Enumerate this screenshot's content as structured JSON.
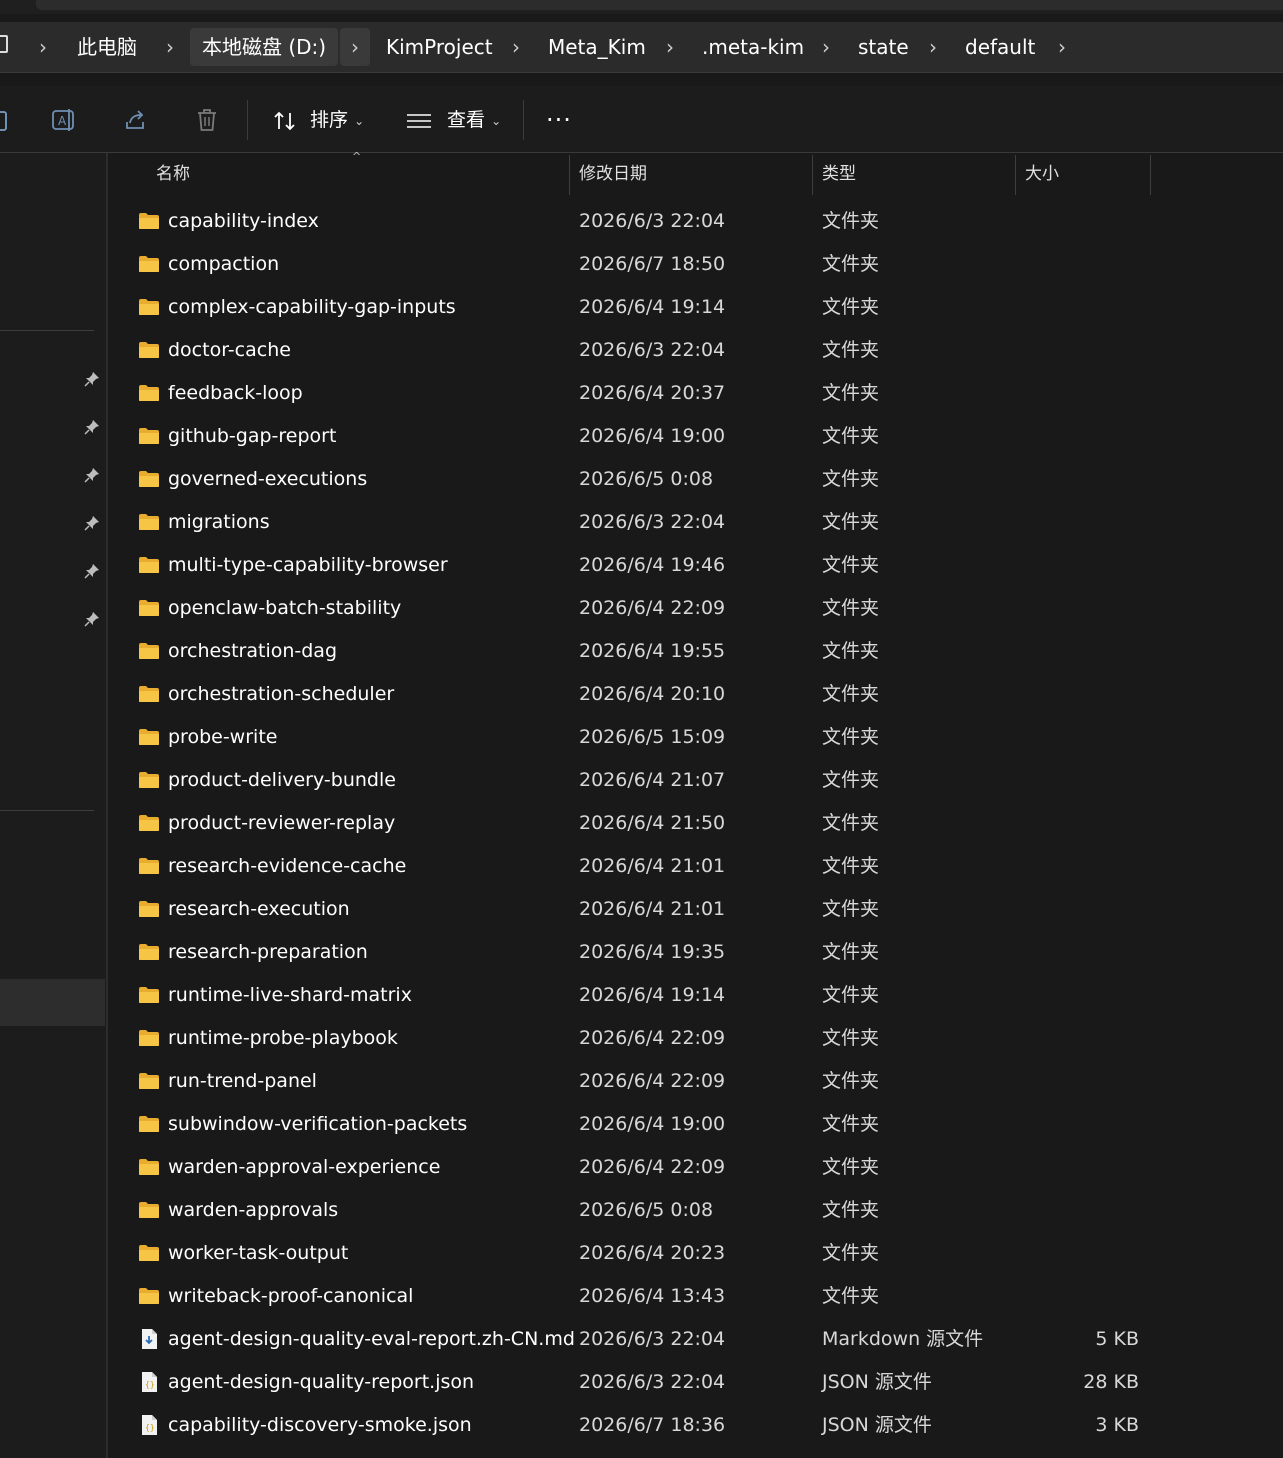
{
  "breadcrumb": [
    "此电脑",
    "本地磁盘 (D:)",
    "KimProject",
    "Meta_Kim",
    ".meta-kim",
    "state",
    "default"
  ],
  "toolbar": {
    "sort_label": "排序",
    "view_label": "查看",
    "more_label": "···"
  },
  "columns": {
    "name": "名称",
    "modified": "修改日期",
    "type": "类型",
    "size": "大小"
  },
  "files": [
    {
      "name": "capability-index",
      "modified": "2026/6/3 22:04",
      "type": "文件夹",
      "size": "",
      "icon": "folder-icon"
    },
    {
      "name": "compaction",
      "modified": "2026/6/7 18:50",
      "type": "文件夹",
      "size": "",
      "icon": "folder-icon"
    },
    {
      "name": "complex-capability-gap-inputs",
      "modified": "2026/6/4 19:14",
      "type": "文件夹",
      "size": "",
      "icon": "folder-icon"
    },
    {
      "name": "doctor-cache",
      "modified": "2026/6/3 22:04",
      "type": "文件夹",
      "size": "",
      "icon": "folder-icon"
    },
    {
      "name": "feedback-loop",
      "modified": "2026/6/4 20:37",
      "type": "文件夹",
      "size": "",
      "icon": "folder-icon"
    },
    {
      "name": "github-gap-report",
      "modified": "2026/6/4 19:00",
      "type": "文件夹",
      "size": "",
      "icon": "folder-icon"
    },
    {
      "name": "governed-executions",
      "modified": "2026/6/5 0:08",
      "type": "文件夹",
      "size": "",
      "icon": "folder-icon"
    },
    {
      "name": "migrations",
      "modified": "2026/6/3 22:04",
      "type": "文件夹",
      "size": "",
      "icon": "folder-icon"
    },
    {
      "name": "multi-type-capability-browser",
      "modified": "2026/6/4 19:46",
      "type": "文件夹",
      "size": "",
      "icon": "folder-icon"
    },
    {
      "name": "openclaw-batch-stability",
      "modified": "2026/6/4 22:09",
      "type": "文件夹",
      "size": "",
      "icon": "folder-icon"
    },
    {
      "name": "orchestration-dag",
      "modified": "2026/6/4 19:55",
      "type": "文件夹",
      "size": "",
      "icon": "folder-icon"
    },
    {
      "name": "orchestration-scheduler",
      "modified": "2026/6/4 20:10",
      "type": "文件夹",
      "size": "",
      "icon": "folder-icon"
    },
    {
      "name": "probe-write",
      "modified": "2026/6/5 15:09",
      "type": "文件夹",
      "size": "",
      "icon": "folder-icon"
    },
    {
      "name": "product-delivery-bundle",
      "modified": "2026/6/4 21:07",
      "type": "文件夹",
      "size": "",
      "icon": "folder-icon"
    },
    {
      "name": "product-reviewer-replay",
      "modified": "2026/6/4 21:50",
      "type": "文件夹",
      "size": "",
      "icon": "folder-icon"
    },
    {
      "name": "research-evidence-cache",
      "modified": "2026/6/4 21:01",
      "type": "文件夹",
      "size": "",
      "icon": "folder-icon"
    },
    {
      "name": "research-execution",
      "modified": "2026/6/4 21:01",
      "type": "文件夹",
      "size": "",
      "icon": "folder-icon"
    },
    {
      "name": "research-preparation",
      "modified": "2026/6/4 19:35",
      "type": "文件夹",
      "size": "",
      "icon": "folder-icon"
    },
    {
      "name": "runtime-live-shard-matrix",
      "modified": "2026/6/4 19:14",
      "type": "文件夹",
      "size": "",
      "icon": "folder-icon"
    },
    {
      "name": "runtime-probe-playbook",
      "modified": "2026/6/4 22:09",
      "type": "文件夹",
      "size": "",
      "icon": "folder-icon"
    },
    {
      "name": "run-trend-panel",
      "modified": "2026/6/4 22:09",
      "type": "文件夹",
      "size": "",
      "icon": "folder-icon"
    },
    {
      "name": "subwindow-verification-packets",
      "modified": "2026/6/4 19:00",
      "type": "文件夹",
      "size": "",
      "icon": "folder-icon"
    },
    {
      "name": "warden-approval-experience",
      "modified": "2026/6/4 22:09",
      "type": "文件夹",
      "size": "",
      "icon": "folder-icon"
    },
    {
      "name": "warden-approvals",
      "modified": "2026/6/5 0:08",
      "type": "文件夹",
      "size": "",
      "icon": "folder-icon"
    },
    {
      "name": "worker-task-output",
      "modified": "2026/6/4 20:23",
      "type": "文件夹",
      "size": "",
      "icon": "folder-icon"
    },
    {
      "name": "writeback-proof-canonical",
      "modified": "2026/6/4 13:43",
      "type": "文件夹",
      "size": "",
      "icon": "folder-icon"
    },
    {
      "name": "agent-design-quality-eval-report.zh-CN.md",
      "modified": "2026/6/3 22:04",
      "type": "Markdown 源文件",
      "size": "5 KB",
      "icon": "markdown-file-icon"
    },
    {
      "name": "agent-design-quality-report.json",
      "modified": "2026/6/3 22:04",
      "type": "JSON 源文件",
      "size": "28 KB",
      "icon": "json-file-icon"
    },
    {
      "name": "capability-discovery-smoke.json",
      "modified": "2026/6/7 18:36",
      "type": "JSON 源文件",
      "size": "3 KB",
      "icon": "json-file-icon"
    }
  ],
  "colors": {
    "folder": "#f6c545",
    "background": "#191919",
    "accent": "#4aa3ff"
  }
}
